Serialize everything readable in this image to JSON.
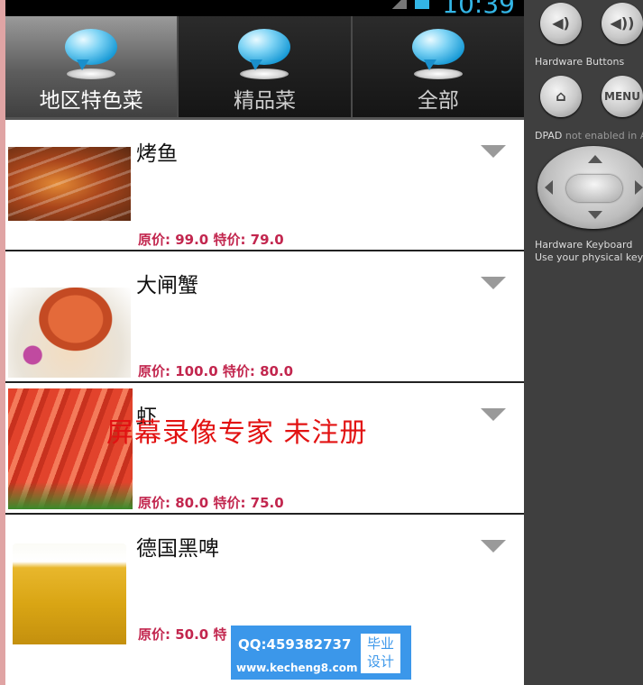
{
  "status_bar": {
    "time": "10:39"
  },
  "tabs": [
    {
      "label": "地区特色菜",
      "active": true
    },
    {
      "label": "精品菜",
      "active": false
    },
    {
      "label": "全部",
      "active": false
    }
  ],
  "dishes": [
    {
      "name": "烤鱼",
      "price_text": "原价: 99.0  特价: 79.0"
    },
    {
      "name": "大闸蟹",
      "price_text": "原价: 100.0  特价: 80.0"
    },
    {
      "name": "虾",
      "price_text": "原价: 80.0  特价: 75.0"
    },
    {
      "name": "德国黑啤",
      "price_text": "原价: 50.0  特"
    }
  ],
  "overlay": {
    "watermark": "屏幕录像专家  未注册",
    "ad_qq": "QQ:459382737",
    "ad_site": "www.kecheng8.com",
    "ad_box_line1": "毕业",
    "ad_box_line2": "设计"
  },
  "emulator_panel": {
    "hardware_buttons_label": "Hardware Buttons",
    "menu_label": "MENU",
    "dpad_label_prefix": "DPAD",
    "dpad_label_suffix": " not enabled in AV",
    "keyboard_label": "Hardware Keyboard",
    "keyboard_hint": "Use your physical keyb"
  },
  "colors": {
    "price_red": "#c2264e",
    "status_blue": "#33b5e5",
    "watermark_red": "#e21212",
    "ad_blue": "#3b97ea"
  }
}
